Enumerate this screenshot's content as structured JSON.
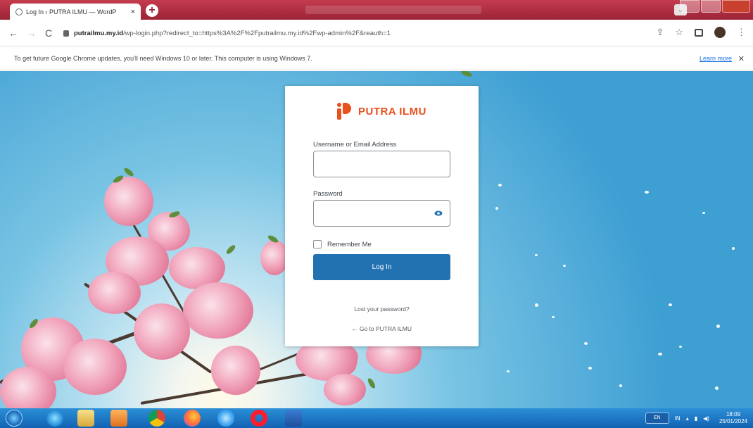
{
  "browser": {
    "tab_title": "Log In ‹ PUTRA ILMU — WordP",
    "tab_close": "×",
    "new_tab": "+",
    "back": "←",
    "forward": "→",
    "reload": "C",
    "url_host": "putrailmu.my.id",
    "url_path": "/wp-login.php?redirect_to=https%3A%2F%2Fputrailmu.my.id%2Fwp-admin%2F&reauth=1",
    "share_icon": "share-icon",
    "bookmark_star": "☆",
    "menu": "⋮",
    "tab_dropdown": "⌄"
  },
  "infobar": {
    "message": "To get future Google Chrome updates, you'll need Windows 10 or later. This computer is using Windows 7.",
    "learn_more": "Learn more",
    "close": "✕"
  },
  "login": {
    "brand_name": "PUTRA ILMU",
    "username_label": "Username or Email Address",
    "username_value": "",
    "password_label": "Password",
    "password_value": "",
    "remember_label": "Remember Me",
    "submit_label": "Log In",
    "lost_password": "Lost your password?",
    "back_link": "← Go to PUTRA ILMU"
  },
  "taskbar": {
    "tray_kbd": "EN",
    "tray_lang": "IN",
    "time": "18:09",
    "date": "25/01/2024"
  },
  "colors": {
    "brand": "#e8501c",
    "button": "#2271b1",
    "titlebar": "#9c2436",
    "taskbar": "#1363b3"
  }
}
